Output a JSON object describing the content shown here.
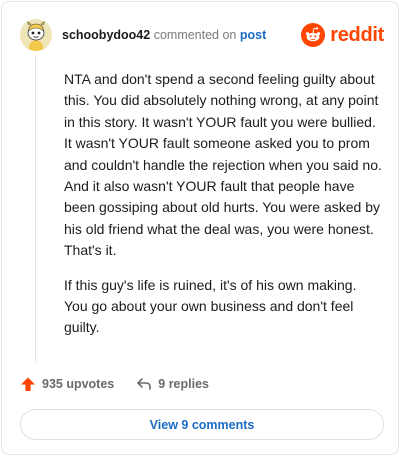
{
  "comment": {
    "username": "schoobydoo42",
    "commented_on_text": "commented on",
    "post_link_label": "post",
    "brand": "reddit",
    "paragraphs": [
      "NTA and don't spend a second feeling guilty about this. You did absolutely nothing wrong, at any point in this story. It wasn't YOUR fault you were bullied. It wasn't YOUR fault someone asked you to prom and couldn't handle the rejection when you said no. And it also wasn't YOUR fault that people have been gossiping about old hurts. You were asked by his old friend what the deal was, you were honest. That's it.",
      "If this guy's life is ruined, it's of his own making. You go about your own business and don't feel guilty."
    ],
    "upvotes_label": "935 upvotes",
    "replies_label": "9 replies",
    "view_comments_label": "View 9 comments"
  },
  "icons": {
    "avatar": "snoo-avatar-yellow",
    "brand_logo": "reddit-snoo-icon",
    "upvote": "upvote-arrow-icon",
    "reply": "reply-arrow-icon"
  },
  "colors": {
    "brand": "#ff4500",
    "link": "#1a6bc4",
    "muted": "#6a6a6a"
  }
}
